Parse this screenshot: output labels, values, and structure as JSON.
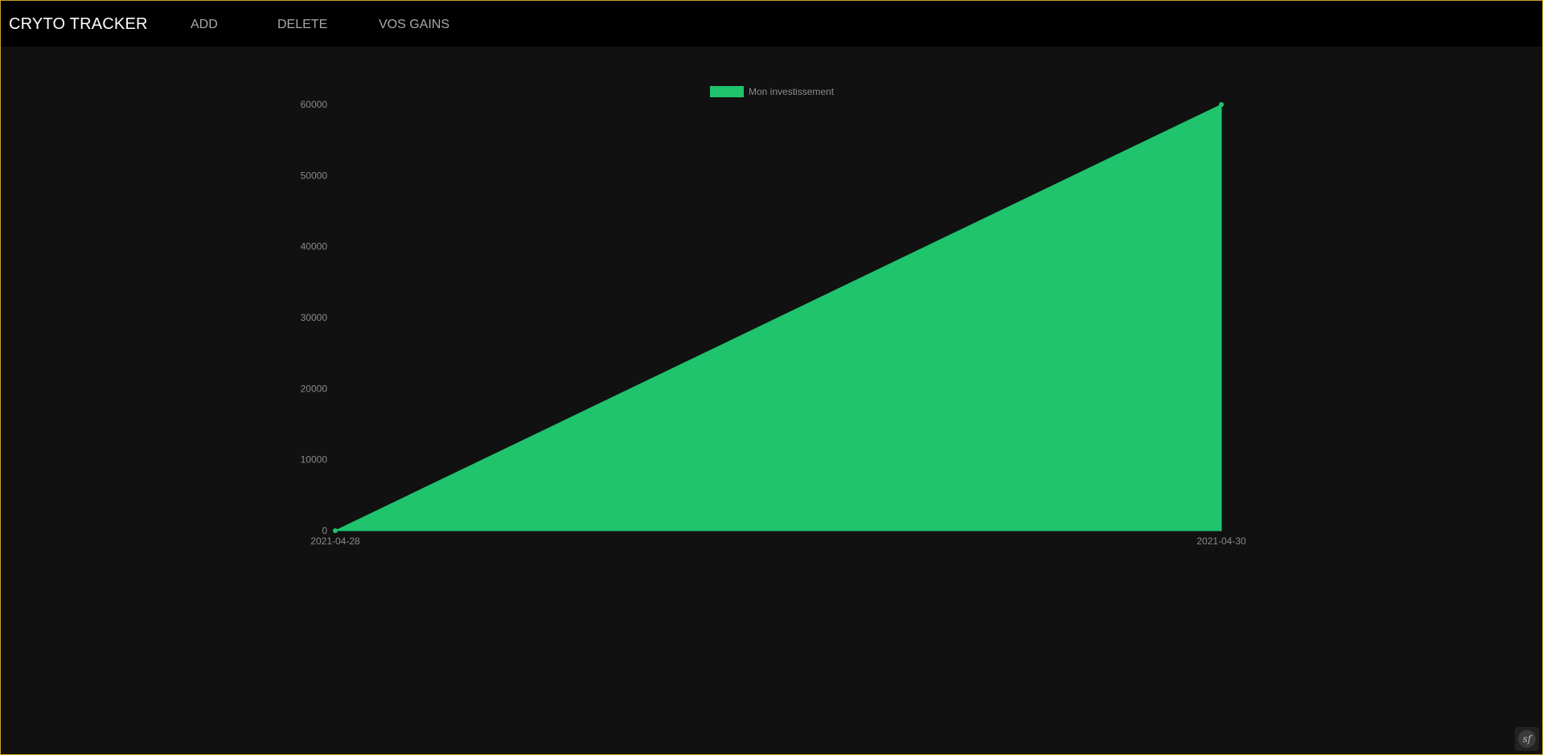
{
  "navbar": {
    "brand": "CRYTO TRACKER",
    "links": [
      {
        "label": "ADD"
      },
      {
        "label": "DELETE"
      },
      {
        "label": "VOS GAINS"
      }
    ]
  },
  "colors": {
    "navbar_bg": "#000000",
    "page_bg": "#111111",
    "series_fill": "#1fc46d",
    "text_muted": "#8a8a8a",
    "frame_border": "#c9a227"
  },
  "chart_data": {
    "type": "area",
    "title": "",
    "xlabel": "",
    "ylabel": "",
    "categories": [
      "2021-04-28",
      "2021-04-30"
    ],
    "series": [
      {
        "name": "Mon investissement",
        "values": [
          0,
          60000
        ],
        "color": "#1fc46d"
      }
    ],
    "y_ticks": [
      0,
      10000,
      20000,
      30000,
      40000,
      50000,
      60000
    ],
    "ylim": [
      0,
      60000
    ],
    "grid": false,
    "legend_position": "top"
  },
  "footer_badge": {
    "icon": "symfony-logo-icon",
    "label": "sf"
  }
}
